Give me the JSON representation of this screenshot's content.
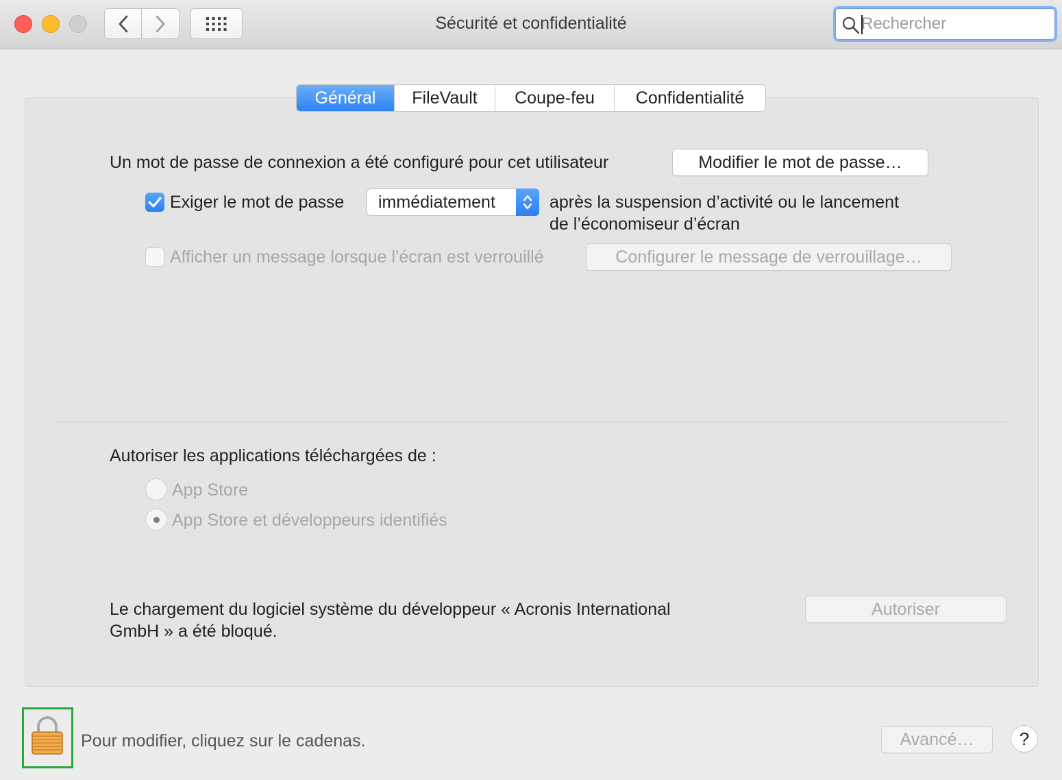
{
  "window": {
    "title": "Sécurité et confidentialité"
  },
  "search": {
    "placeholder": "Rechercher",
    "value": ""
  },
  "tabs": [
    {
      "label": "Général",
      "active": true
    },
    {
      "label": "FileVault",
      "active": false
    },
    {
      "label": "Coupe-feu",
      "active": false
    },
    {
      "label": "Confidentialité",
      "active": false
    }
  ],
  "general": {
    "password_set_text": "Un mot de passe de connexion a été configuré pour cet utilisateur",
    "change_password_button": "Modifier le mot de passe…",
    "require_password_label": "Exiger le mot de passe",
    "require_password_checked": true,
    "require_password_delay": "immédiatement",
    "after_text_line1": "après la suspension d’activité ou le lancement",
    "after_text_line2": "de l’économiseur d’écran",
    "show_message_label": "Afficher un message lorsque l’écran est verrouillé",
    "show_message_checked": false,
    "configure_message_button": "Configurer le message de verrouillage…"
  },
  "allow_apps": {
    "heading": "Autoriser les applications téléchargées de :",
    "options": [
      {
        "label": "App Store",
        "selected": false
      },
      {
        "label": "App Store et développeurs identifiés",
        "selected": true
      }
    ]
  },
  "blocked": {
    "line1": "Le chargement du logiciel système du développeur « Acronis International",
    "line2": "GmbH » a été bloqué.",
    "allow_button": "Autoriser"
  },
  "footer": {
    "lock_text": "Pour modifier, cliquez sur le cadenas.",
    "advanced_button": "Avancé…",
    "help_label": "?"
  },
  "colors": {
    "accent": "#2d83f4",
    "highlight": "#27a83a"
  }
}
